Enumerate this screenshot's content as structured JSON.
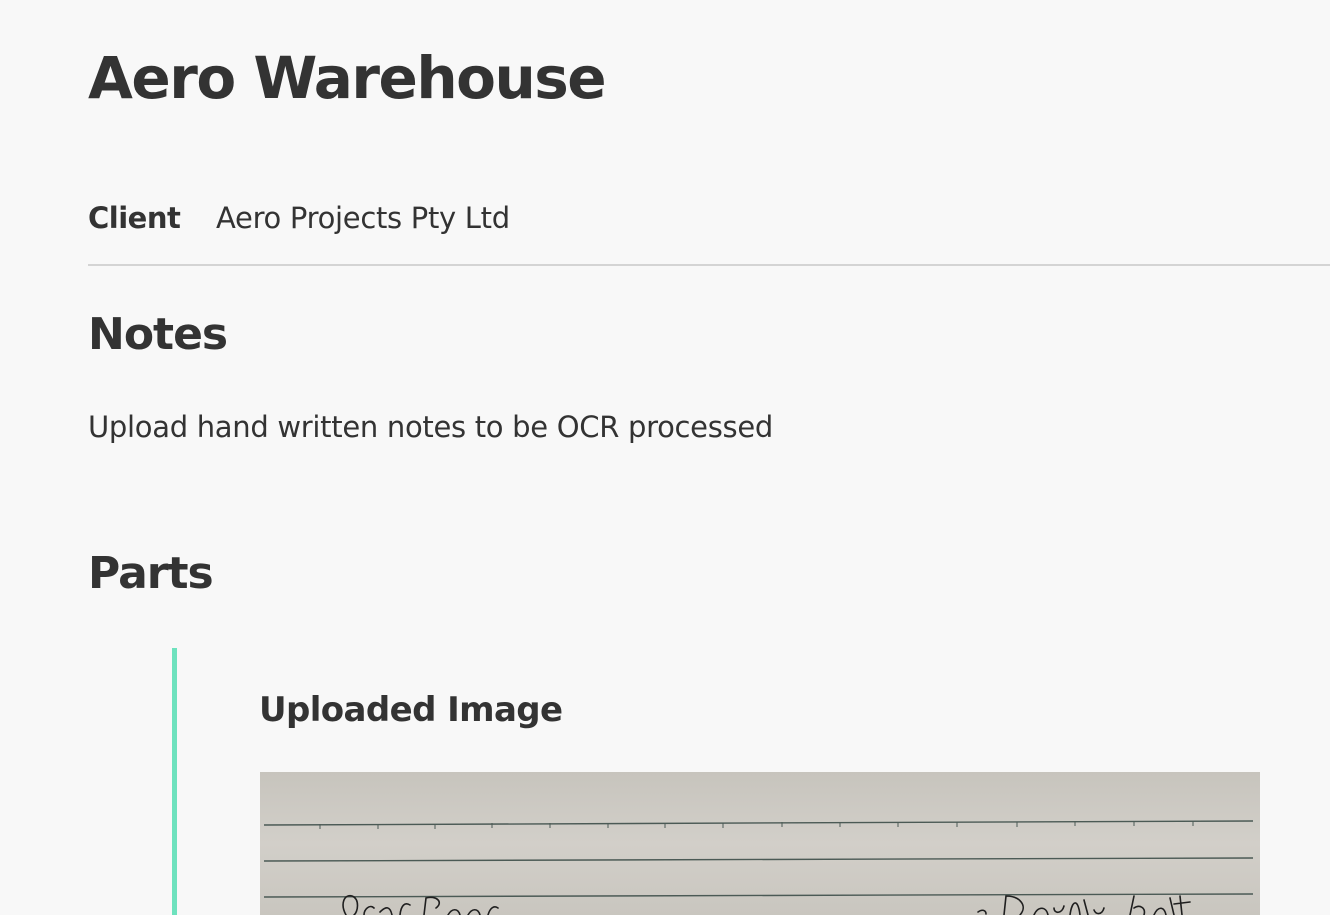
{
  "page": {
    "title": "Aero Warehouse"
  },
  "client": {
    "label": "Client",
    "value": "Aero Projects Pty Ltd"
  },
  "notes": {
    "heading": "Notes",
    "description": "Upload hand written notes to be OCR processed"
  },
  "parts": {
    "heading": "Parts",
    "items": [
      {
        "image_heading": "Uploaded Image",
        "image_kind": "handwritten-notes-photo"
      }
    ]
  },
  "colors": {
    "accent": "#6ee2be",
    "text": "#333333",
    "divider": "#d4d4d4",
    "background": "#f8f8f8",
    "paper": "#cdcac3",
    "ruled_line": "#4b5a55",
    "ink": "#1f1f1f"
  }
}
